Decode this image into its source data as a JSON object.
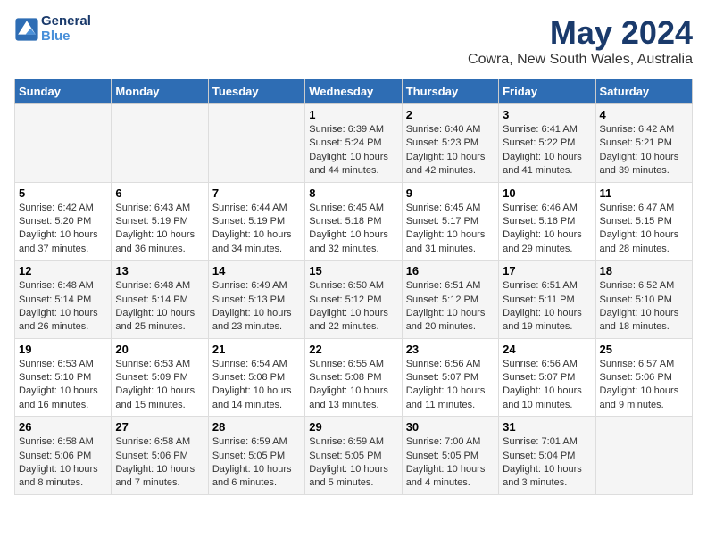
{
  "header": {
    "logo_line1": "General",
    "logo_line2": "Blue",
    "title": "May 2024",
    "subtitle": "Cowra, New South Wales, Australia"
  },
  "days": [
    "Sunday",
    "Monday",
    "Tuesday",
    "Wednesday",
    "Thursday",
    "Friday",
    "Saturday"
  ],
  "weeks": [
    [
      {
        "date": "",
        "content": ""
      },
      {
        "date": "",
        "content": ""
      },
      {
        "date": "",
        "content": ""
      },
      {
        "date": "1",
        "content": "Sunrise: 6:39 AM\nSunset: 5:24 PM\nDaylight: 10 hours\nand 44 minutes."
      },
      {
        "date": "2",
        "content": "Sunrise: 6:40 AM\nSunset: 5:23 PM\nDaylight: 10 hours\nand 42 minutes."
      },
      {
        "date": "3",
        "content": "Sunrise: 6:41 AM\nSunset: 5:22 PM\nDaylight: 10 hours\nand 41 minutes."
      },
      {
        "date": "4",
        "content": "Sunrise: 6:42 AM\nSunset: 5:21 PM\nDaylight: 10 hours\nand 39 minutes."
      }
    ],
    [
      {
        "date": "5",
        "content": "Sunrise: 6:42 AM\nSunset: 5:20 PM\nDaylight: 10 hours\nand 37 minutes."
      },
      {
        "date": "6",
        "content": "Sunrise: 6:43 AM\nSunset: 5:19 PM\nDaylight: 10 hours\nand 36 minutes."
      },
      {
        "date": "7",
        "content": "Sunrise: 6:44 AM\nSunset: 5:19 PM\nDaylight: 10 hours\nand 34 minutes."
      },
      {
        "date": "8",
        "content": "Sunrise: 6:45 AM\nSunset: 5:18 PM\nDaylight: 10 hours\nand 32 minutes."
      },
      {
        "date": "9",
        "content": "Sunrise: 6:45 AM\nSunset: 5:17 PM\nDaylight: 10 hours\nand 31 minutes."
      },
      {
        "date": "10",
        "content": "Sunrise: 6:46 AM\nSunset: 5:16 PM\nDaylight: 10 hours\nand 29 minutes."
      },
      {
        "date": "11",
        "content": "Sunrise: 6:47 AM\nSunset: 5:15 PM\nDaylight: 10 hours\nand 28 minutes."
      }
    ],
    [
      {
        "date": "12",
        "content": "Sunrise: 6:48 AM\nSunset: 5:14 PM\nDaylight: 10 hours\nand 26 minutes."
      },
      {
        "date": "13",
        "content": "Sunrise: 6:48 AM\nSunset: 5:14 PM\nDaylight: 10 hours\nand 25 minutes."
      },
      {
        "date": "14",
        "content": "Sunrise: 6:49 AM\nSunset: 5:13 PM\nDaylight: 10 hours\nand 23 minutes."
      },
      {
        "date": "15",
        "content": "Sunrise: 6:50 AM\nSunset: 5:12 PM\nDaylight: 10 hours\nand 22 minutes."
      },
      {
        "date": "16",
        "content": "Sunrise: 6:51 AM\nSunset: 5:12 PM\nDaylight: 10 hours\nand 20 minutes."
      },
      {
        "date": "17",
        "content": "Sunrise: 6:51 AM\nSunset: 5:11 PM\nDaylight: 10 hours\nand 19 minutes."
      },
      {
        "date": "18",
        "content": "Sunrise: 6:52 AM\nSunset: 5:10 PM\nDaylight: 10 hours\nand 18 minutes."
      }
    ],
    [
      {
        "date": "19",
        "content": "Sunrise: 6:53 AM\nSunset: 5:10 PM\nDaylight: 10 hours\nand 16 minutes."
      },
      {
        "date": "20",
        "content": "Sunrise: 6:53 AM\nSunset: 5:09 PM\nDaylight: 10 hours\nand 15 minutes."
      },
      {
        "date": "21",
        "content": "Sunrise: 6:54 AM\nSunset: 5:08 PM\nDaylight: 10 hours\nand 14 minutes."
      },
      {
        "date": "22",
        "content": "Sunrise: 6:55 AM\nSunset: 5:08 PM\nDaylight: 10 hours\nand 13 minutes."
      },
      {
        "date": "23",
        "content": "Sunrise: 6:56 AM\nSunset: 5:07 PM\nDaylight: 10 hours\nand 11 minutes."
      },
      {
        "date": "24",
        "content": "Sunrise: 6:56 AM\nSunset: 5:07 PM\nDaylight: 10 hours\nand 10 minutes."
      },
      {
        "date": "25",
        "content": "Sunrise: 6:57 AM\nSunset: 5:06 PM\nDaylight: 10 hours\nand 9 minutes."
      }
    ],
    [
      {
        "date": "26",
        "content": "Sunrise: 6:58 AM\nSunset: 5:06 PM\nDaylight: 10 hours\nand 8 minutes."
      },
      {
        "date": "27",
        "content": "Sunrise: 6:58 AM\nSunset: 5:06 PM\nDaylight: 10 hours\nand 7 minutes."
      },
      {
        "date": "28",
        "content": "Sunrise: 6:59 AM\nSunset: 5:05 PM\nDaylight: 10 hours\nand 6 minutes."
      },
      {
        "date": "29",
        "content": "Sunrise: 6:59 AM\nSunset: 5:05 PM\nDaylight: 10 hours\nand 5 minutes."
      },
      {
        "date": "30",
        "content": "Sunrise: 7:00 AM\nSunset: 5:05 PM\nDaylight: 10 hours\nand 4 minutes."
      },
      {
        "date": "31",
        "content": "Sunrise: 7:01 AM\nSunset: 5:04 PM\nDaylight: 10 hours\nand 3 minutes."
      },
      {
        "date": "",
        "content": ""
      }
    ]
  ]
}
